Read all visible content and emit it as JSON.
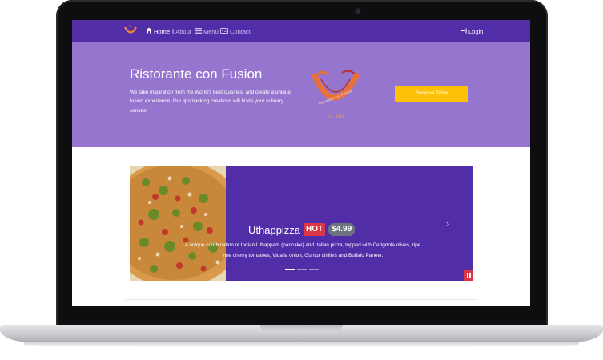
{
  "nav": {
    "items": [
      {
        "label": "Home",
        "icon": "home-icon"
      },
      {
        "label": "About",
        "icon": "info-icon"
      },
      {
        "label": "Menu",
        "icon": "list-icon"
      },
      {
        "label": "Contact",
        "icon": "address-card-icon"
      }
    ],
    "login_label": "Login",
    "login_icon": "sign-in-icon"
  },
  "jumbotron": {
    "title": "Ristorante con Fusion",
    "text": "We take inspiration from the World's best cuisines, and create a unique fusion experience. Our lipsmacking creations will tickle your culinary senses!",
    "logo_text": "Ristorante con Fusion",
    "logo_year": "Est. 2013",
    "reserve_label": "Reserve Table"
  },
  "carousel": {
    "dish_name": "Uthappizza",
    "badge_hot": "HOT",
    "price": "$4.99",
    "description": "A unique combination of Indian Uthappam (pancake) and Italian pizza, topped with Cerignola olives, ripe vine cherry tomatoes, Vidalia onion, Guntur chillies and Buffalo Paneer.",
    "slide_count": 3,
    "active_slide": 1
  },
  "colors": {
    "navbar": "#512da8",
    "jumbotron": "#9575cd",
    "accent": "#ffc107",
    "hot": "#dc3545",
    "price": "#6c757d"
  }
}
